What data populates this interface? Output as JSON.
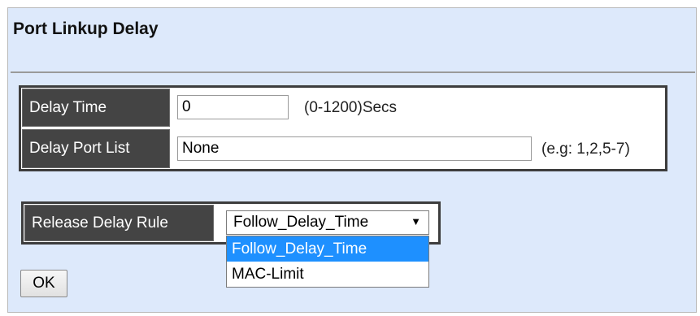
{
  "page": {
    "title": "Port Linkup Delay"
  },
  "delay_time": {
    "label": "Delay Time",
    "value": "0",
    "hint": "(0-1200)Secs"
  },
  "delay_port_list": {
    "label": "Delay Port List",
    "value": "None",
    "hint": "(e.g: 1,2,5-7)"
  },
  "release_delay_rule": {
    "label": "Release Delay Rule",
    "selected": "Follow_Delay_Time",
    "options": [
      "Follow_Delay_Time",
      "MAC-Limit"
    ],
    "caret": "▼"
  },
  "ok_button": {
    "label": "OK"
  },
  "colors": {
    "panel_bg": "#dde9fb",
    "label_bg": "#444444",
    "highlight": "#1e90ff"
  }
}
